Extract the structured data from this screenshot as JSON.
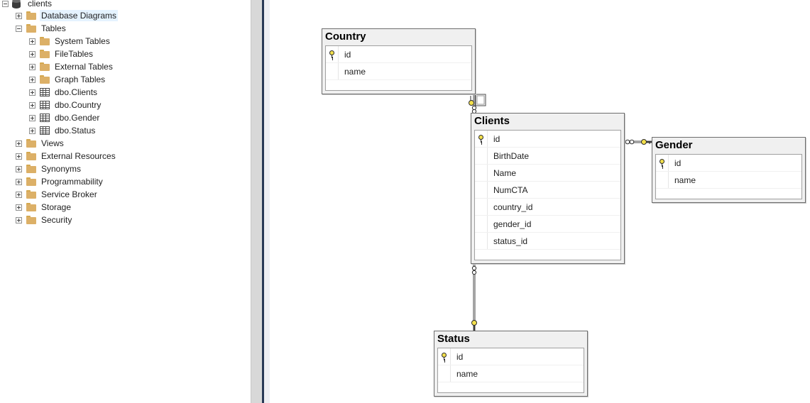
{
  "explorer": {
    "root": "clients",
    "nodes": {
      "database_diagrams": "Database Diagrams",
      "tables": "Tables",
      "system_tables": "System Tables",
      "filetables": "FileTables",
      "external_tables": "External Tables",
      "graph_tables": "Graph Tables",
      "dbo_clients": "dbo.Clients",
      "dbo_country": "dbo.Country",
      "dbo_gender": "dbo.Gender",
      "dbo_status": "dbo.Status",
      "views": "Views",
      "external_resources": "External Resources",
      "synonyms": "Synonyms",
      "programmability": "Programmability",
      "service_broker": "Service Broker",
      "storage": "Storage",
      "security": "Security"
    }
  },
  "diagram": {
    "country": {
      "title": "Country",
      "columns": [
        "id",
        "name"
      ]
    },
    "clients": {
      "title": "Clients",
      "columns": [
        "id",
        "BirthDate",
        "Name",
        "NumCTA",
        "country_id",
        "gender_id",
        "status_id"
      ]
    },
    "gender": {
      "title": "Gender",
      "columns": [
        "id",
        "name"
      ]
    },
    "status": {
      "title": "Status",
      "columns": [
        "id",
        "name"
      ]
    }
  },
  "colors": {
    "splitter_accent": "#293955",
    "key_yellow": "#f3e04c",
    "selection": "#e5f3ff"
  }
}
